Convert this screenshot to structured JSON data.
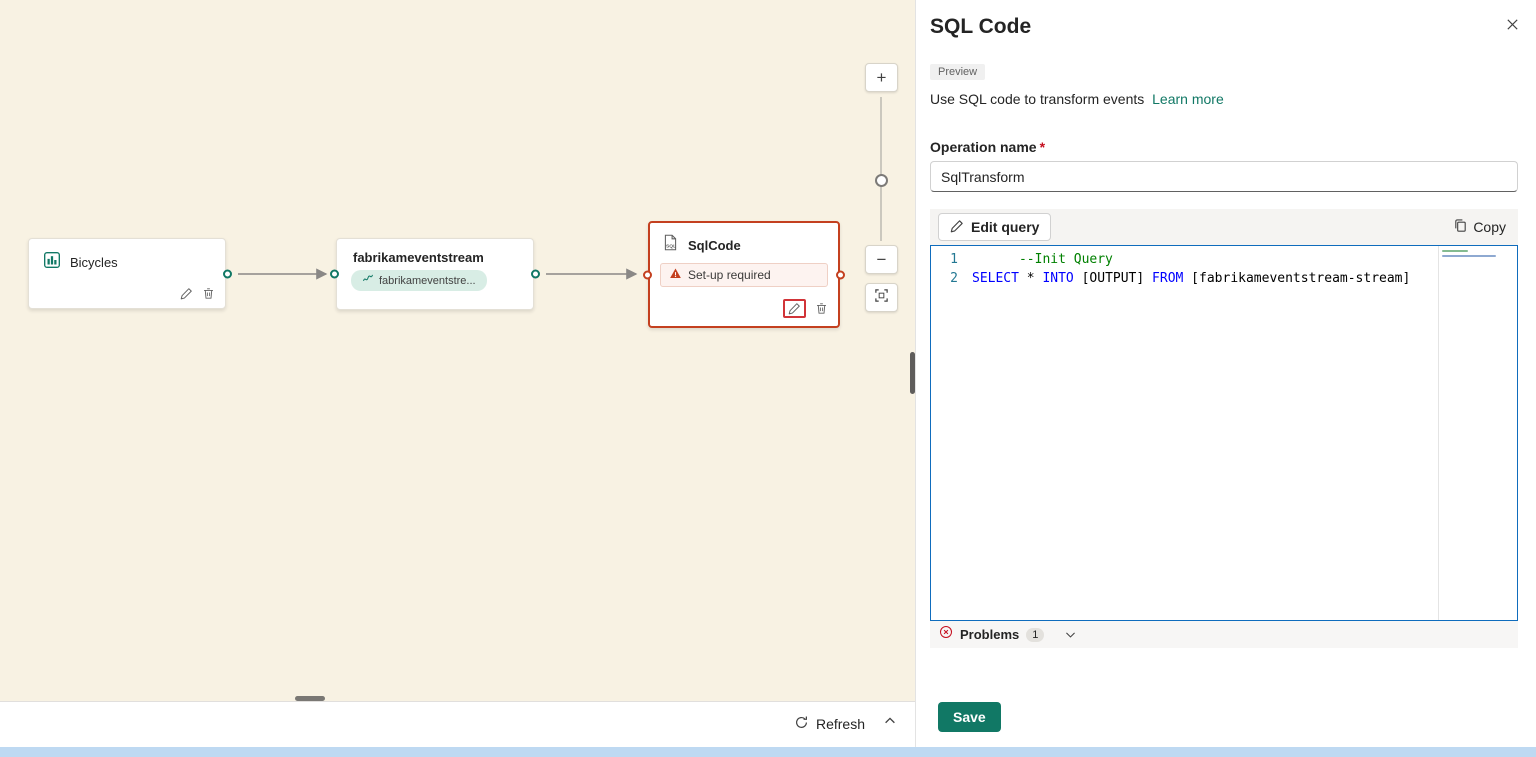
{
  "canvas": {
    "nodes": {
      "bicycles": {
        "label": "Bicycles"
      },
      "eventstream": {
        "label": "fabrikameventstream",
        "pill": "fabrikameventstre..."
      },
      "sqlcode": {
        "label": "SqlCode",
        "warning": "Set-up required"
      }
    },
    "zoom": {
      "plus": "+",
      "minus": "−"
    },
    "refresh_label": "Refresh"
  },
  "panel": {
    "title": "SQL Code",
    "preview_badge": "Preview",
    "description": "Use SQL code to transform events",
    "learn_more": "Learn more",
    "operation_name": {
      "label": "Operation name",
      "required": "*",
      "value": "SqlTransform"
    },
    "toolbar": {
      "edit_query": "Edit query",
      "copy": "Copy"
    },
    "editor": {
      "lines": [
        {
          "num": "1",
          "segments": [
            {
              "text": "      ",
              "type": "plain"
            },
            {
              "text": "--Init Query",
              "type": "comment"
            }
          ]
        },
        {
          "num": "2",
          "segments": [
            {
              "text": "SELECT",
              "type": "keyword"
            },
            {
              "text": " * ",
              "type": "plain"
            },
            {
              "text": "INTO",
              "type": "keyword"
            },
            {
              "text": " [OUTPUT] ",
              "type": "plain"
            },
            {
              "text": "FROM",
              "type": "keyword"
            },
            {
              "text": " [fabrikameventstream-stream]",
              "type": "plain"
            }
          ]
        }
      ]
    },
    "problems": {
      "label": "Problems",
      "count": "1"
    },
    "save_label": "Save"
  },
  "colors": {
    "accent": "#117865",
    "warning": "#c4401f",
    "error": "#c50f1f",
    "editor_border": "#0f6cbd",
    "canvas_bg": "#f8f2e3",
    "highlight_red": "#d13438"
  }
}
